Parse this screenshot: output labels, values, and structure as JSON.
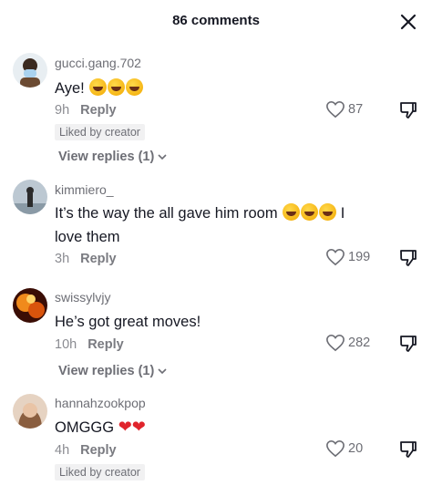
{
  "header": {
    "title": "86 comments"
  },
  "comments": [
    {
      "username": "gucci.gang.702",
      "text": "Aye!",
      "text_suffix": "",
      "emojis": 3,
      "time": "9h",
      "reply_label": "Reply",
      "likes": "87",
      "badge": "Liked by creator",
      "view_replies": "View replies (1)",
      "avatar_colors": [
        "#e8eef2",
        "#3a2a20"
      ]
    },
    {
      "username": "kimmiero_",
      "text": "It’s the way the all gave him room",
      "text_suffix": "I love them",
      "emojis": 3,
      "time": "3h",
      "reply_label": "Reply",
      "likes": "199",
      "avatar_colors": [
        "#bcc8d2",
        "#2b2b2b"
      ]
    },
    {
      "username": "swissylvjy",
      "text": "He’s got great moves!",
      "time": "10h",
      "reply_label": "Reply",
      "likes": "282",
      "view_replies": "View replies (1)",
      "avatar_colors": [
        "#f08a1c",
        "#3a0d05"
      ]
    },
    {
      "username": "hannahzookpop",
      "text": "OMGGG",
      "hearts": 2,
      "time": "4h",
      "reply_label": "Reply",
      "likes": "20",
      "badge": "Liked by creator",
      "avatar_colors": [
        "#d8b79b",
        "#8a5e3f"
      ]
    }
  ],
  "icons": {
    "close": "close-icon",
    "like": "heart-outline-icon",
    "dislike": "thumbs-down-icon",
    "chevron": "chevron-down-icon"
  }
}
